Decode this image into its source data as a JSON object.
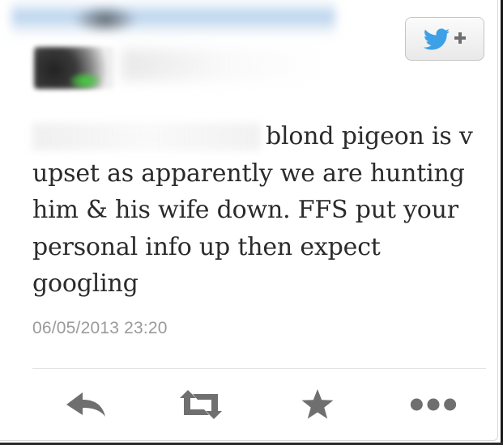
{
  "tweet": {
    "text": "blond pigeon is v upset as apparently we are hunting him & his wife down. FFS put your personal info up then expect googling",
    "timestamp": "06/05/2013 23:20"
  },
  "header": {
    "follow_button_icon": "twitter-bird-plus-icon"
  },
  "actions": [
    {
      "name": "reply",
      "icon": "reply-arrow-icon"
    },
    {
      "name": "retweet",
      "icon": "retweet-icon"
    },
    {
      "name": "favorite",
      "icon": "star-icon"
    },
    {
      "name": "more",
      "icon": "ellipsis-icon"
    }
  ],
  "colors": {
    "text": "#2b2b2b",
    "timestamp": "#9a9a9a",
    "icon": "#6f6f6f",
    "twitter_blue": "#3ea0e6"
  }
}
